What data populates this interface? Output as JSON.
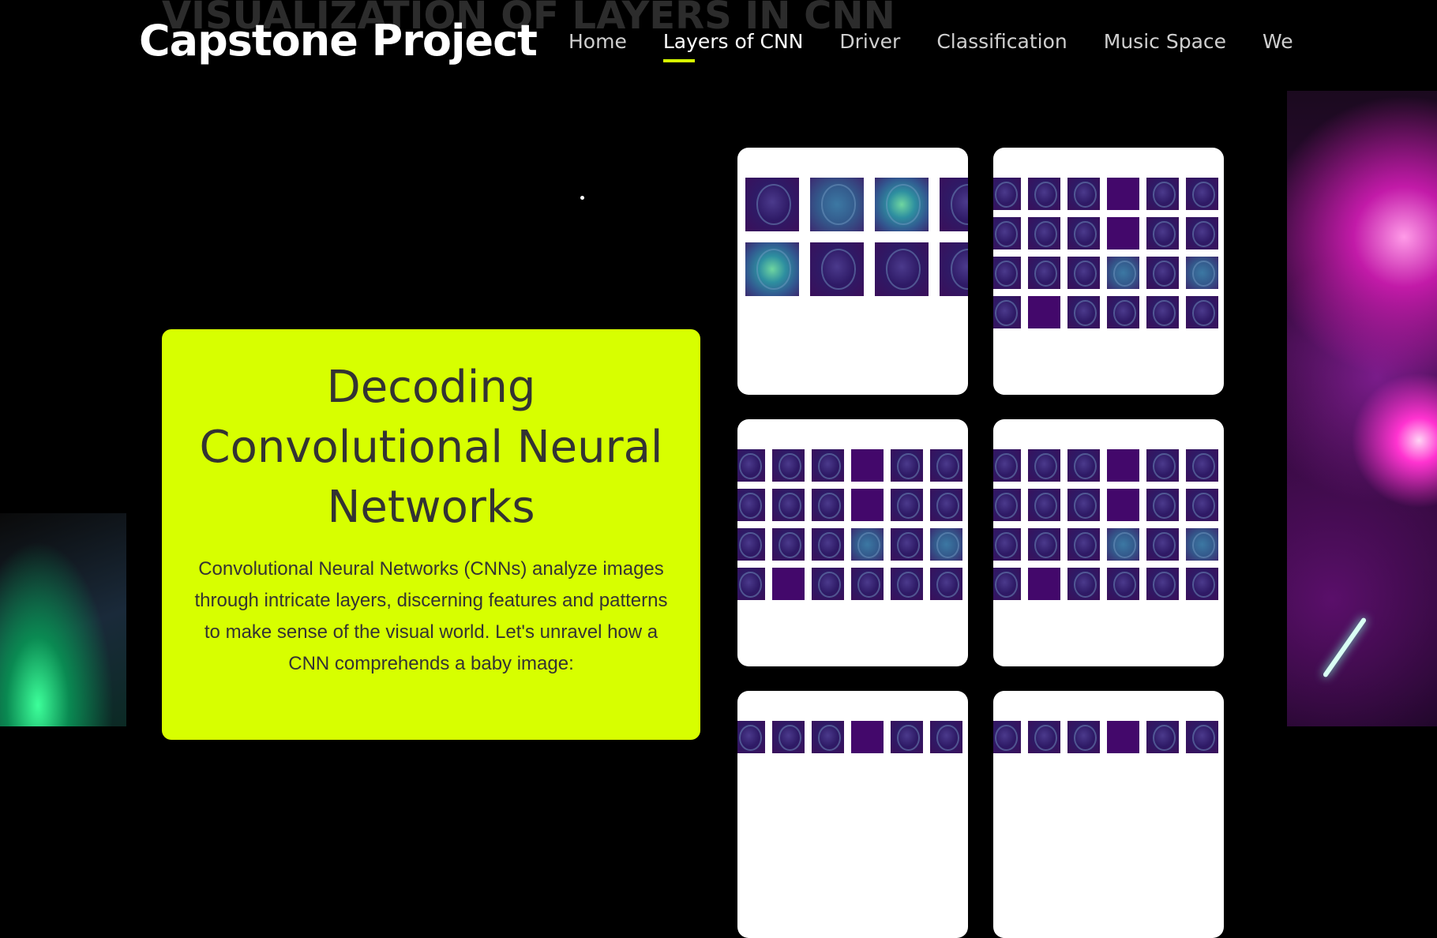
{
  "page": {
    "ghost_title": "VISUALIZATION OF LAYERS IN CNN"
  },
  "header": {
    "brand": "Capstone Project",
    "nav": [
      {
        "label": "Home",
        "active": false
      },
      {
        "label": "Layers of CNN",
        "active": true
      },
      {
        "label": "Driver",
        "active": false
      },
      {
        "label": "Classification",
        "active": false
      },
      {
        "label": "Music Space",
        "active": false
      },
      {
        "label": "We",
        "active": false
      }
    ],
    "active_indicator_color": "#d7ff00"
  },
  "hero_card": {
    "title_line1": "Decoding",
    "title_line2": "Convolutional Neural",
    "title_line3": "Networks",
    "description": "Convolutional Neural Networks (CNNs) analyze images through intricate layers, discerning features and patterns to make sense of the visual world. Let's unravel how a CNN comprehends a baby image:",
    "background_color": "#d7ff00"
  },
  "feature_map_tiles": [
    {
      "name": "layer-1-feature-maps",
      "grid": "4x2"
    },
    {
      "name": "layer-2-feature-maps",
      "grid": "7x4"
    },
    {
      "name": "layer-3-feature-maps",
      "grid": "7x4"
    },
    {
      "name": "layer-4-feature-maps",
      "grid": "7x4"
    },
    {
      "name": "layer-5-feature-maps",
      "grid": "partial"
    },
    {
      "name": "layer-6-feature-maps",
      "grid": "partial"
    }
  ]
}
